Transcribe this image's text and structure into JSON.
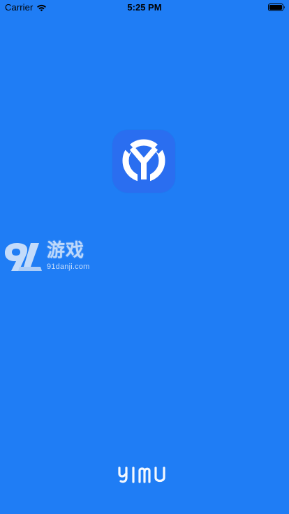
{
  "status_bar": {
    "carrier": "Carrier",
    "time": "5:25 PM",
    "icons": [
      "wifi-icon",
      "battery-icon"
    ]
  },
  "splash": {
    "app_icon": "yimu-app-icon",
    "watermark": {
      "title": "游戏",
      "domain": "91danji.com"
    },
    "brand_logo_text": "YIMU"
  },
  "colors": {
    "background": "#1f7df5",
    "app_icon_bg": "#2a6ef0",
    "logo_white": "#ffffff"
  }
}
